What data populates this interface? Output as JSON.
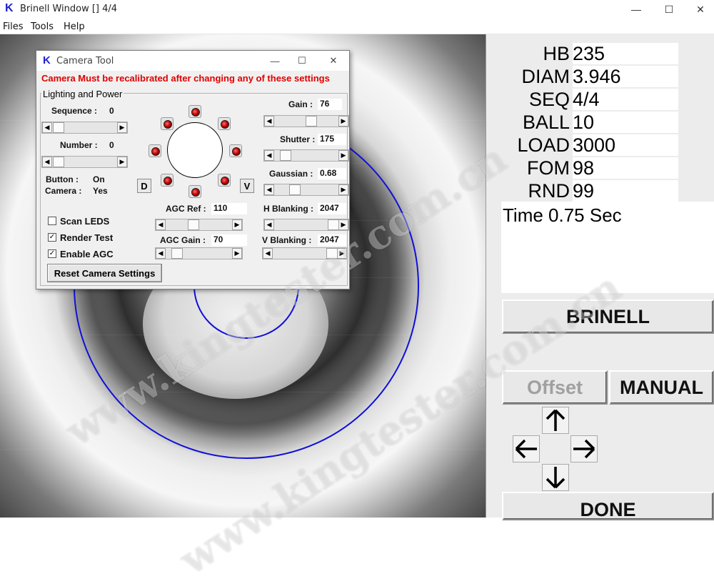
{
  "window": {
    "logo": "K",
    "title": "Brinell Window [] 4/4",
    "minimize": "—",
    "maximize": "☐",
    "close": "✕"
  },
  "menu": [
    "Files",
    "Tools",
    "Help"
  ],
  "watermark": [
    "www.kingtester.com.cn",
    "www.kingtester.com.cn"
  ],
  "readouts": [
    {
      "label": "HB",
      "value": "235"
    },
    {
      "label": "DIAM",
      "value": "3.946"
    },
    {
      "label": "SEQ",
      "value": "4/4"
    },
    {
      "label": "BALL",
      "value": "10"
    },
    {
      "label": "LOAD",
      "value": "3000"
    },
    {
      "label": "FOM",
      "value": "98"
    },
    {
      "label": "RND",
      "value": "99"
    }
  ],
  "time_text": "Time 0.75 Sec",
  "buttons": {
    "brinell": "BRINELL",
    "offset": "Offset",
    "manual": "MANUAL",
    "done": "DONE"
  },
  "arrows": {
    "up": "🡑",
    "left": "🡐",
    "right": "🡒",
    "down": "🡓"
  },
  "dialog": {
    "logo": "K",
    "title": "Camera Tool",
    "warning": "Camera Must be recalibrated after changing any of these settings",
    "group_title": "Lighting and Power",
    "sequence": {
      "label": "Sequence :",
      "value": "0"
    },
    "number": {
      "label": "Number :",
      "value": "0"
    },
    "button_status": {
      "label": "Button :",
      "value": "On"
    },
    "camera_status": {
      "label": "Camera :",
      "value": "Yes"
    },
    "checkboxes": [
      {
        "label": "Scan LEDS",
        "checked": false
      },
      {
        "label": "Render Test",
        "checked": true
      },
      {
        "label": "Enable AGC",
        "checked": true
      }
    ],
    "reset_label": "Reset Camera Settings",
    "d_button": "D",
    "v_button": "V",
    "agc_ref": {
      "label": "AGC Ref :",
      "value": "110"
    },
    "agc_gain": {
      "label": "AGC Gain :",
      "value": "70"
    },
    "gain": {
      "label": "Gain :",
      "value": "76"
    },
    "shutter": {
      "label": "Shutter :",
      "value": "175"
    },
    "gaussian": {
      "label": "Gaussian :",
      "value": "0.68"
    },
    "h_blanking": {
      "label": "H Blanking :",
      "value": "2047"
    },
    "v_blanking": {
      "label": "V Blanking :",
      "value": "2047"
    },
    "check_mark": "✓"
  },
  "colors": {
    "overlay_circle": "#1010d8",
    "warning": "#e00000",
    "logo": "#1f1fd1",
    "offset_disabled": "#a0a0a0"
  }
}
